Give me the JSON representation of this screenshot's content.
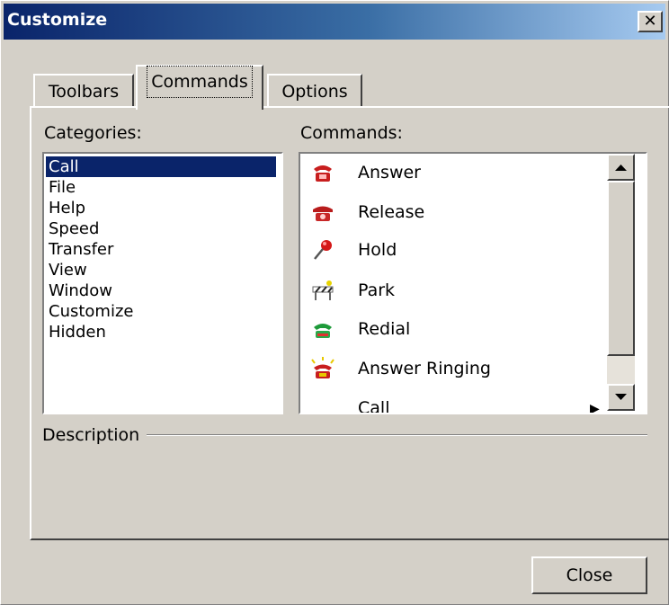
{
  "window": {
    "title": "Customize",
    "close_glyph": "✕"
  },
  "tabs": [
    {
      "label": "Toolbars"
    },
    {
      "label": "Commands",
      "active": true
    },
    {
      "label": "Options"
    }
  ],
  "categories": {
    "label": "Categories:",
    "selected": "Call",
    "items": [
      "Call",
      "File",
      "Help",
      "Speed",
      "Transfer",
      "View",
      "Window",
      "Customize",
      "Hidden"
    ]
  },
  "commands": {
    "label": "Commands:",
    "items": [
      {
        "label": "Answer",
        "icon": "phone-answer-icon"
      },
      {
        "label": "Release",
        "icon": "phone-release-icon"
      },
      {
        "label": "Hold",
        "icon": "pushpin-icon"
      },
      {
        "label": "Park",
        "icon": "barrier-icon"
      },
      {
        "label": "Redial",
        "icon": "redial-icon"
      },
      {
        "label": "Answer Ringing",
        "icon": "ringing-phone-icon"
      },
      {
        "label": "Call",
        "icon": ""
      }
    ]
  },
  "description": {
    "label": "Description"
  },
  "buttons": {
    "close": "Close"
  },
  "colors": {
    "selection": "#0a246a",
    "face": "#d4d0c8",
    "titlebar_start": "#0a246a",
    "titlebar_end": "#a6caf0"
  }
}
